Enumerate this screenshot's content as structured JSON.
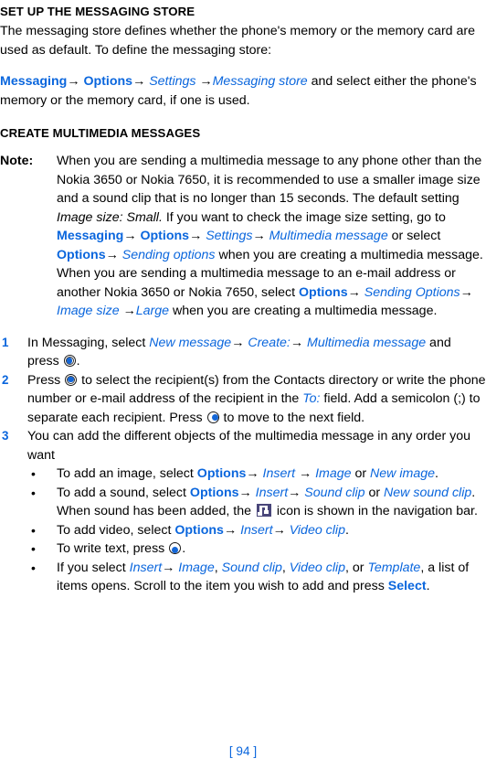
{
  "document": {
    "page_number": "[ 94 ]"
  },
  "sections": [
    {
      "heading": "SET UP THE MESSAGING STORE",
      "intro": "The messaging store defines whether the phone's memory or the memory card are used as default. To define the messaging store:",
      "path": {
        "item1": "Messaging",
        "arrow1": "→",
        "item2": "Options",
        "arrow2": "→",
        "item3": "Settings",
        "arrow3": "→",
        "item4": "Messaging store",
        "tail": " and select either the phone's memory or the memory card, if one is used."
      }
    },
    {
      "heading": "CREATE MULTIMEDIA MESSAGES"
    }
  ],
  "note": {
    "label": "Note:",
    "t1": "When you are sending a multimedia message to any phone other than the Nokia 3650 or Nokia 7650, it is recommended to use a smaller image size and a sound clip that is no longer than 15 seconds. The default setting ",
    "image_size_small": "Image size: Small.",
    "t2": " If you want to check the image size setting, go to ",
    "messaging": "Messaging",
    "a1": "→",
    "options1": "Options",
    "a2": "→",
    "settings": "Settings",
    "a3": "→",
    "multimedia_message": "Multimedia message",
    "t3": " or select ",
    "options2": "Options",
    "a4": "→",
    "sending_options_i": "Sending options",
    "t4": " when you are creating a multimedia message. When you are sending a multimedia message to an e-mail address or another Nokia 3650 or Nokia 7650, select ",
    "options3": "Options",
    "a5": "→",
    "sending_options2": "Sending Options",
    "a6": "→",
    "image_size": "Image size",
    "a7": "→",
    "large": "Large",
    "t5": " when you are creating a multimedia message."
  },
  "steps": [
    {
      "num": "1",
      "t1": "In Messaging, select ",
      "new_message": "New message",
      "a1": "→",
      "create": "Create:",
      "a2": "→",
      "multimedia_message": "Multimedia message",
      "t2": " and press ",
      "icon": "joystick-center-icon",
      "t3": "."
    },
    {
      "num": "2",
      "t1": "Press ",
      "icon1": "joystick-center-icon",
      "t2": " to select the recipient(s) from the Contacts directory or write the phone number or e-mail address of the recipient in the ",
      "to_field": "To:",
      "t3": " field. Add a semicolon (;) to separate each recipient. Press ",
      "icon2": "joystick-right-icon",
      "t4": " to move to the next field."
    },
    {
      "num": "3",
      "t1": "You can add the different objects of the multimedia message in any order you want"
    }
  ],
  "bullets": [
    {
      "dot": "•",
      "t1": "To add an image, select ",
      "options": "Options",
      "a1": "→",
      "insert": "Insert",
      "a2": "→",
      "image": "Image",
      "t2": " or ",
      "new_image": "New image",
      "t3": "."
    },
    {
      "dot": "•",
      "t1": "To add a sound, select ",
      "options": "Options",
      "a1": "→",
      "insert": "Insert",
      "a2": "→",
      "sound_clip": "Sound clip",
      "t2": " or ",
      "new_sound_clip": "New sound clip",
      "t3": ". When sound has been added, the ",
      "icon": "sound-note-icon",
      "t4": " icon is shown in the navigation bar."
    },
    {
      "dot": "•",
      "t1": "To add video, select ",
      "options": "Options",
      "a1": "→",
      "insert": "Insert",
      "a2": "→",
      "video_clip": "Video clip",
      "t2": "."
    },
    {
      "dot": "•",
      "t1": "To write text, press ",
      "icon": "joystick-down-icon",
      "t2": "."
    },
    {
      "dot": "•",
      "t1": "If you select ",
      "insert": "Insert",
      "a1": "→",
      "image": "Image",
      "c1": ", ",
      "sound_clip": "Sound clip",
      "c2": ", ",
      "video_clip": "Video clip",
      "c3": ", or ",
      "template": "Template",
      "t2": ", a list of items opens. Scroll to the item you wish to add and press ",
      "select": "Select",
      "t3": "."
    }
  ],
  "colors": {
    "link_blue": "#0a66dd",
    "text_black": "#000000",
    "icon_ball_blue": "#1466d6",
    "sound_icon_bg": "#49467a"
  }
}
